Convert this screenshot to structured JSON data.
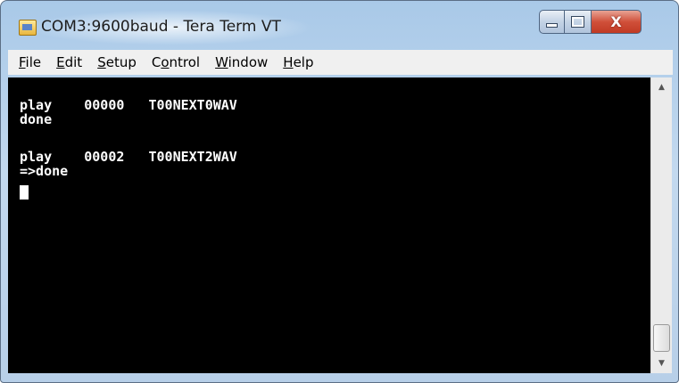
{
  "window": {
    "title": "COM3:9600baud - Tera Term VT",
    "close_symbol": "X"
  },
  "menu": [
    {
      "key": "F",
      "rest": "ile"
    },
    {
      "key": "E",
      "rest": "dit"
    },
    {
      "key": "S",
      "rest": "etup"
    },
    {
      "pre": "C",
      "key": "o",
      "rest": "ntrol"
    },
    {
      "key": "W",
      "rest": "indow"
    },
    {
      "key": "H",
      "rest": "elp"
    }
  ],
  "terminal": {
    "lines": [
      "play    00000   T00NEXT0WAV",
      "done",
      "play    00002   T00NEXT2WAV",
      "=>done"
    ],
    "background": "#000000",
    "foreground": "#ffffff"
  },
  "icons": {
    "app": "teraterm-icon",
    "minimize": "minimize-icon",
    "maximize": "maximize-icon",
    "close": "close-icon",
    "scroll_up": "scroll-up-arrow-icon",
    "scroll_down": "scroll-down-arrow-icon"
  }
}
